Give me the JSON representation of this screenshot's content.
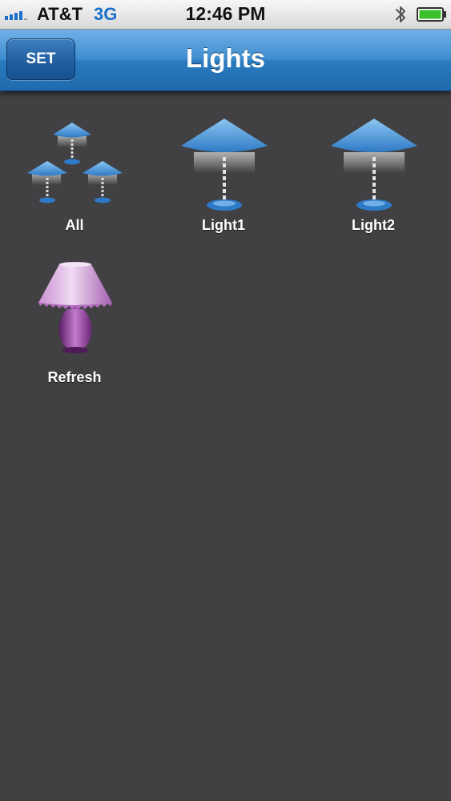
{
  "status_bar": {
    "carrier": "AT&T",
    "network": "3G",
    "time": "12:46 PM",
    "signal_bars": 4,
    "icons": [
      "signal-icon",
      "bluetooth-icon",
      "battery-icon"
    ],
    "battery_level": 0.9
  },
  "nav_bar": {
    "title": "Lights",
    "left_button": "SET"
  },
  "devices": [
    {
      "label": "All",
      "icon": "lamp-group-icon"
    },
    {
      "label": "Light1",
      "icon": "lamp-icon"
    },
    {
      "label": "Light2",
      "icon": "lamp-icon"
    },
    {
      "label": "Refresh",
      "icon": "purple-lamp-icon"
    }
  ],
  "colors": {
    "background": "#414042",
    "nav_bar": "#2a7bc1",
    "lamp_shade_blue": "#3a86d6",
    "lamp_purple": "#8e3d96",
    "network_blue": "#1b6fc9",
    "battery_green": "#3cc12e"
  }
}
